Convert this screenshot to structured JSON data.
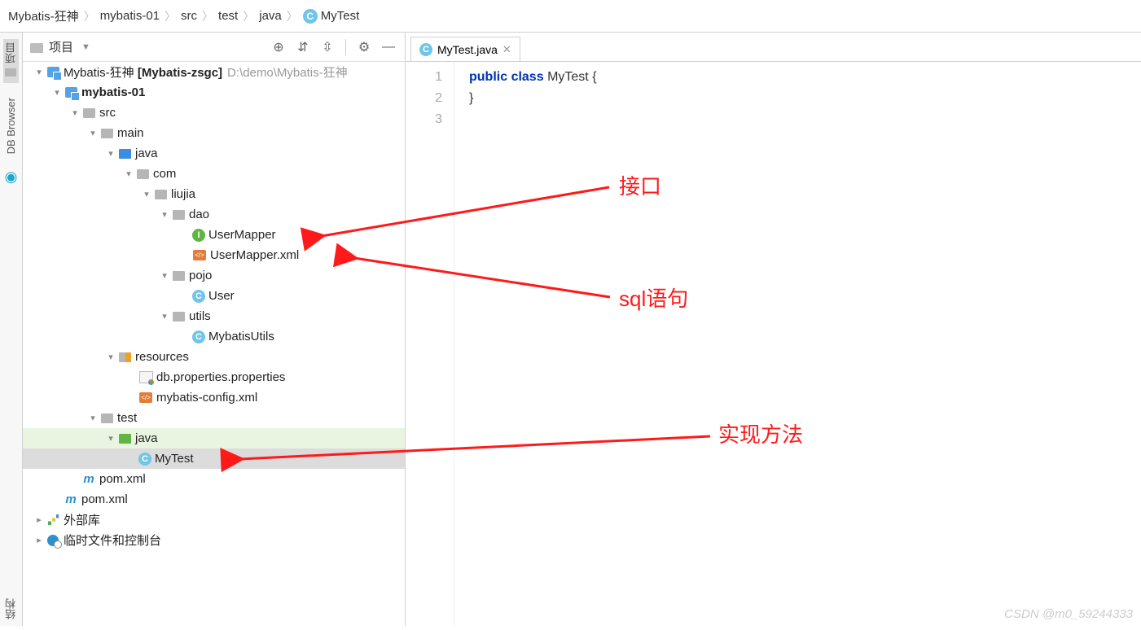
{
  "breadcrumb": [
    "Mybatis-狂神",
    "mybatis-01",
    "src",
    "test",
    "java",
    "MyTest"
  ],
  "panel": {
    "title": "项目",
    "tools": {
      "target": "⊕",
      "expand": "⇵",
      "collapse": "⇳",
      "gear": "⚙",
      "hide": "—"
    }
  },
  "left_tabs": {
    "project": "项目",
    "db": "DB Browser",
    "struct": "结构"
  },
  "tree": {
    "root": {
      "name": "Mybatis-狂神",
      "vcs": "[Mybatis-zsgc]",
      "path": "D:\\demo\\Mybatis-狂神"
    },
    "module": "mybatis-01",
    "src": "src",
    "main": "main",
    "java": "java",
    "com": "com",
    "liujia": "liujia",
    "dao": "dao",
    "userMapper": "UserMapper",
    "userMapperXml": "UserMapper.xml",
    "pojo": "pojo",
    "user": "User",
    "utils": "utils",
    "mybatisUtils": "MybatisUtils",
    "resources": "resources",
    "dbprops": "db.properties.properties",
    "myconfig": "mybatis-config.xml",
    "test": "test",
    "javaTest": "java",
    "myTest": "MyTest",
    "pom1": "pom.xml",
    "pom2": "pom.xml",
    "ext": "外部库",
    "scratch": "临时文件和控制台"
  },
  "editor": {
    "tab": "MyTest.java",
    "lines": [
      "1",
      "2",
      "3"
    ],
    "code": {
      "kw_public": "public",
      "kw_class": "class",
      "cls": "MyTest",
      "brace_open": "{",
      "brace_close": "}"
    }
  },
  "annotations": {
    "a1": "接口",
    "a2": "sql语句",
    "a3": "实现方法"
  },
  "watermark": "CSDN @m0_59244333"
}
